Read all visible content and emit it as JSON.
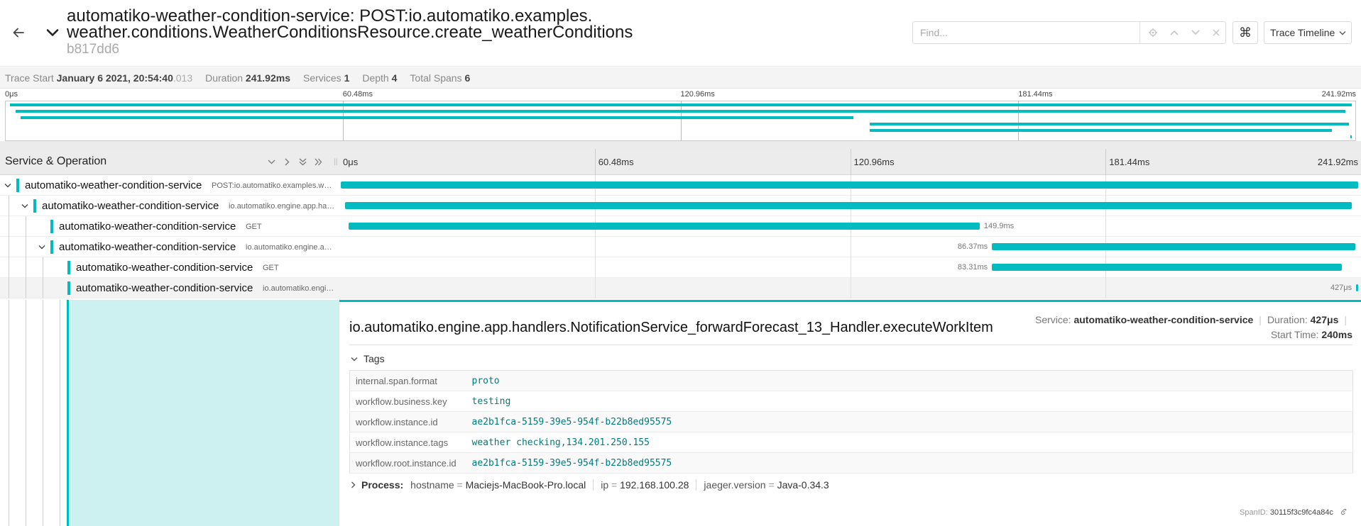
{
  "header": {
    "title_line1": "automatiko-weather-condition-service: POST:io.automatiko.examples.",
    "title_line2": "weather.conditions.WeatherConditionsResource.create_weatherConditions",
    "trace_id": "b817dd6",
    "find_placeholder": "Find...",
    "view_mode": "Trace Timeline"
  },
  "summary": {
    "trace_start_label": "Trace Start",
    "trace_start_value": "January 6 2021, 20:54:40",
    "trace_start_ms": ".013",
    "duration_label": "Duration",
    "duration_value": "241.92ms",
    "services_label": "Services",
    "services_value": "1",
    "depth_label": "Depth",
    "depth_value": "4",
    "total_spans_label": "Total Spans",
    "total_spans_value": "6"
  },
  "minimap": {
    "ticks": [
      "0μs",
      "60.48ms",
      "120.96ms",
      "181.44ms",
      "241.92ms"
    ]
  },
  "timeline_header": {
    "title": "Service & Operation",
    "ticks": [
      "0μs",
      "60.48ms",
      "120.96ms",
      "181.44ms",
      "241.92ms"
    ]
  },
  "spans": [
    {
      "service": "automatiko-weather-condition-service",
      "operation": "POST:io.automatiko.examples.weather.conditions.WeatherConditionsResource.create_weatherConditions",
      "duration": "",
      "start_fraction": 0.0,
      "duration_fraction": 1.0
    },
    {
      "service": "automatiko-weather-condition-service",
      "operation": "io.automatiko.engine.app.handlers.StartProcess",
      "duration": "",
      "start_fraction": 0.004,
      "duration_fraction": 0.99
    },
    {
      "service": "automatiko-weather-condition-service",
      "operation": "GET",
      "duration": "149.9ms",
      "start_fraction": 0.008,
      "duration_fraction": 0.62
    },
    {
      "service": "automatiko-weather-condition-service",
      "operation": "io.automatiko.engine.app.handlers.ExecuteWorkItem",
      "duration": "86.37ms",
      "start_fraction": 0.64,
      "duration_fraction": 0.357
    },
    {
      "service": "automatiko-weather-condition-service",
      "operation": "GET",
      "duration": "83.31ms",
      "start_fraction": 0.64,
      "duration_fraction": 0.344
    },
    {
      "service": "automatiko-weather-condition-service",
      "operation": "io.automatiko.engine.app.handlers.NotificationService_forwardForecast_13_Handler.executeWorkItem",
      "duration": "427μs",
      "start_fraction": 0.998,
      "duration_fraction": 0.002
    }
  ],
  "detail": {
    "title": "io.automatiko.engine.app.handlers.NotificationService_forwardForecast_13_Handler.executeWorkItem",
    "service_label": "Service:",
    "service_value": "automatiko-weather-condition-service",
    "duration_label": "Duration:",
    "duration_value": "427μs",
    "start_label": "Start Time:",
    "start_value": "240ms",
    "tags_label": "Tags",
    "tags": [
      {
        "key": "internal.span.format",
        "value": "proto"
      },
      {
        "key": "workflow.business.key",
        "value": "testing"
      },
      {
        "key": "workflow.instance.id",
        "value": "ae2b1fca-5159-39e5-954f-b22b8ed95575"
      },
      {
        "key": "workflow.instance.tags",
        "value": "weather checking,134.201.250.155"
      },
      {
        "key": "workflow.root.instance.id",
        "value": "ae2b1fca-5159-39e5-954f-b22b8ed95575"
      }
    ],
    "process_label": "Process:",
    "process": [
      {
        "key": "hostname",
        "value": "Maciejs-MacBook-Pro.local"
      },
      {
        "key": "ip",
        "value": "192.168.100.28"
      },
      {
        "key": "jaeger.version",
        "value": "Java-0.34.3"
      }
    ],
    "span_id_label": "SpanID:",
    "span_id_value": "30115f3c9fc4a84c"
  },
  "colors": {
    "accent": "#00bcc1",
    "selected_fill": "#cdf0f0"
  }
}
